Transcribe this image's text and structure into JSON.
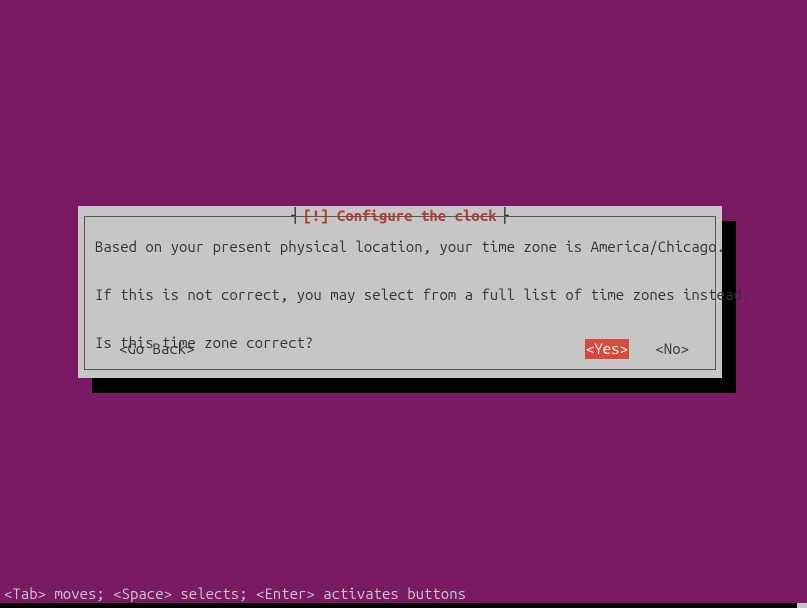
{
  "dialog": {
    "title": "[!] Configure the clock",
    "line1": "Based on your present physical location, your time zone is America/Chicago.",
    "line2": "If this is not correct, you may select from a full list of time zones instead.",
    "line3": "Is this time zone correct?",
    "buttons": {
      "go_back": "<Go Back>",
      "yes": "<Yes>",
      "no": "<No>"
    }
  },
  "status_bar": "<Tab> moves; <Space> selects; <Enter> activates buttons",
  "colors": {
    "background": "#7a1a62",
    "dialog_bg": "#c6c6c6",
    "accent_red": "#b83a2f",
    "highlight_bg": "#d64b3d"
  }
}
